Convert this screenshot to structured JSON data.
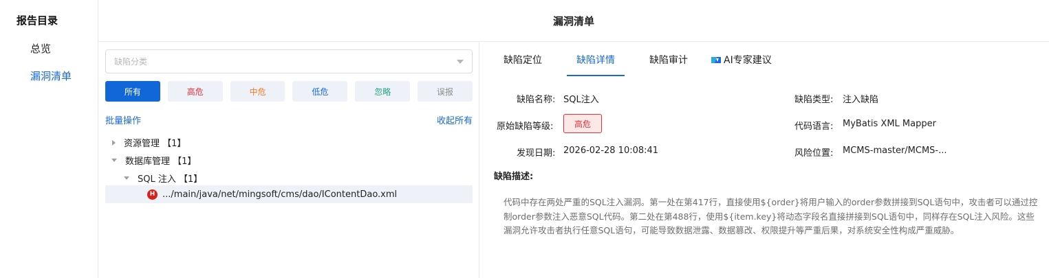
{
  "sidebar": {
    "title": "报告目录",
    "items": [
      {
        "label": "总览",
        "active": false
      },
      {
        "label": "漏洞清单",
        "active": true
      }
    ]
  },
  "header": {
    "title": "漏洞清单"
  },
  "filter": {
    "select_placeholder": "缺陷分类",
    "buttons": [
      {
        "label": "所有",
        "color": "#ffffff",
        "active": true
      },
      {
        "label": "高危",
        "color": "#e0303a"
      },
      {
        "label": "中危",
        "color": "#f07c2a"
      },
      {
        "label": "低危",
        "color": "#1668dc"
      },
      {
        "label": "忽略",
        "color": "#21a67a"
      },
      {
        "label": "误报",
        "color": "#8c8c8c"
      }
    ],
    "batch_label": "批量操作",
    "collapse_label": "收起所有"
  },
  "tree": {
    "nodes": [
      {
        "label": "资源管理 【1】",
        "expanded": false
      },
      {
        "label": "数据库管理 【1】",
        "expanded": true
      },
      {
        "label": "SQL 注入 【1】",
        "expanded": true
      }
    ],
    "leaf": {
      "badge": "H",
      "path": ".../main/java/net/mingsoft/cms/dao/IContentDao.xml"
    }
  },
  "tabs": [
    {
      "label": "缺陷定位",
      "active": false
    },
    {
      "label": "缺陷详情",
      "active": true
    },
    {
      "label": "缺陷审计",
      "active": false
    },
    {
      "label": "AI专家建议",
      "active": false,
      "icon": "ai-icon"
    }
  ],
  "details": {
    "name_label": "缺陷名称:",
    "name_value": "SQL注入",
    "type_label": "缺陷类型:",
    "type_value": "注入缺陷",
    "level_label": "原始缺陷等级:",
    "level_value": "高危",
    "lang_label": "代码语言:",
    "lang_value": "MyBatis XML Mapper",
    "date_label": "发现日期:",
    "date_value": "2026-02-28 10:08:41",
    "location_label": "风险位置:",
    "location_value": "MCMS-master/MCMS-...",
    "desc_title": "缺陷描述:",
    "desc_text": "代码中存在两处严重的SQL注入漏洞。第一处在第417行，直接使用${order}将用户输入的order参数拼接到SQL语句中，攻击者可以通过控制order参数注入恶意SQL代码。第二处在第488行，使用${item.key}将动态字段名直接拼接到SQL语句中，同样存在SQL注入风险。这些漏洞允许攻击者执行任意SQL语句，可能导致数据泄露、数据篡改、权限提升等严重后果，对系统安全性构成严重威胁。"
  }
}
